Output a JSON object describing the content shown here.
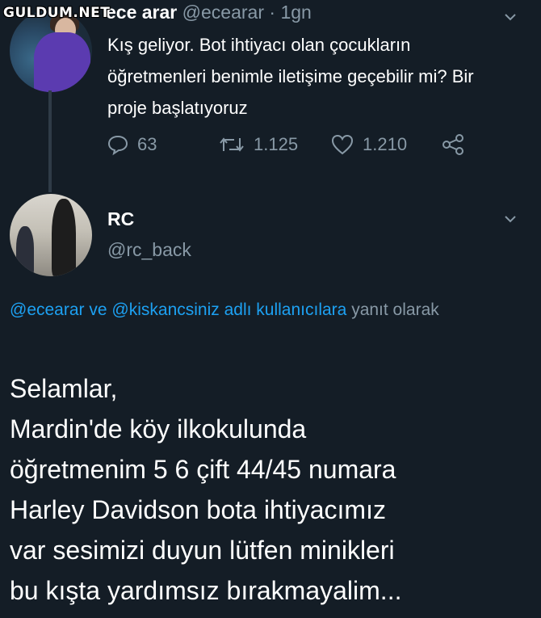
{
  "watermark": "GULDUM.NET",
  "tweet1": {
    "name": "ece arar",
    "handle": "@ecearar",
    "separator": "·",
    "time": "1gn",
    "text": "Kış geliyor. Bot ihtiyacı olan çocukların öğretmenleri benimle iletişime geçebilir mi? Bir proje başlatıyoruz",
    "actions": {
      "reply_count": "63",
      "retweet_count": "1.125",
      "like_count": "1.210",
      "share_icon": "share-icon"
    }
  },
  "tweet2": {
    "name": "RC",
    "handle": "@rc_back",
    "reply_to": {
      "mention1": "@ecearar",
      "connector": "ve",
      "mention2": "@kiskancsiniz adlı kullanıcılara",
      "suffix": "yanıt olarak"
    },
    "text_lines": [
      "Selamlar,",
      "Mardin'de köy ilkokulunda",
      "öğretmenim 5 6 çift 44/45 numara",
      "Harley Davidson bota ihtiyacımız",
      "var sesimizi duyun lütfen minikleri",
      "bu kışta yardımsız bırakmayalim..."
    ]
  },
  "colors": {
    "background": "#141d26",
    "secondary_text": "#8899a6",
    "link": "#1da1f2"
  }
}
